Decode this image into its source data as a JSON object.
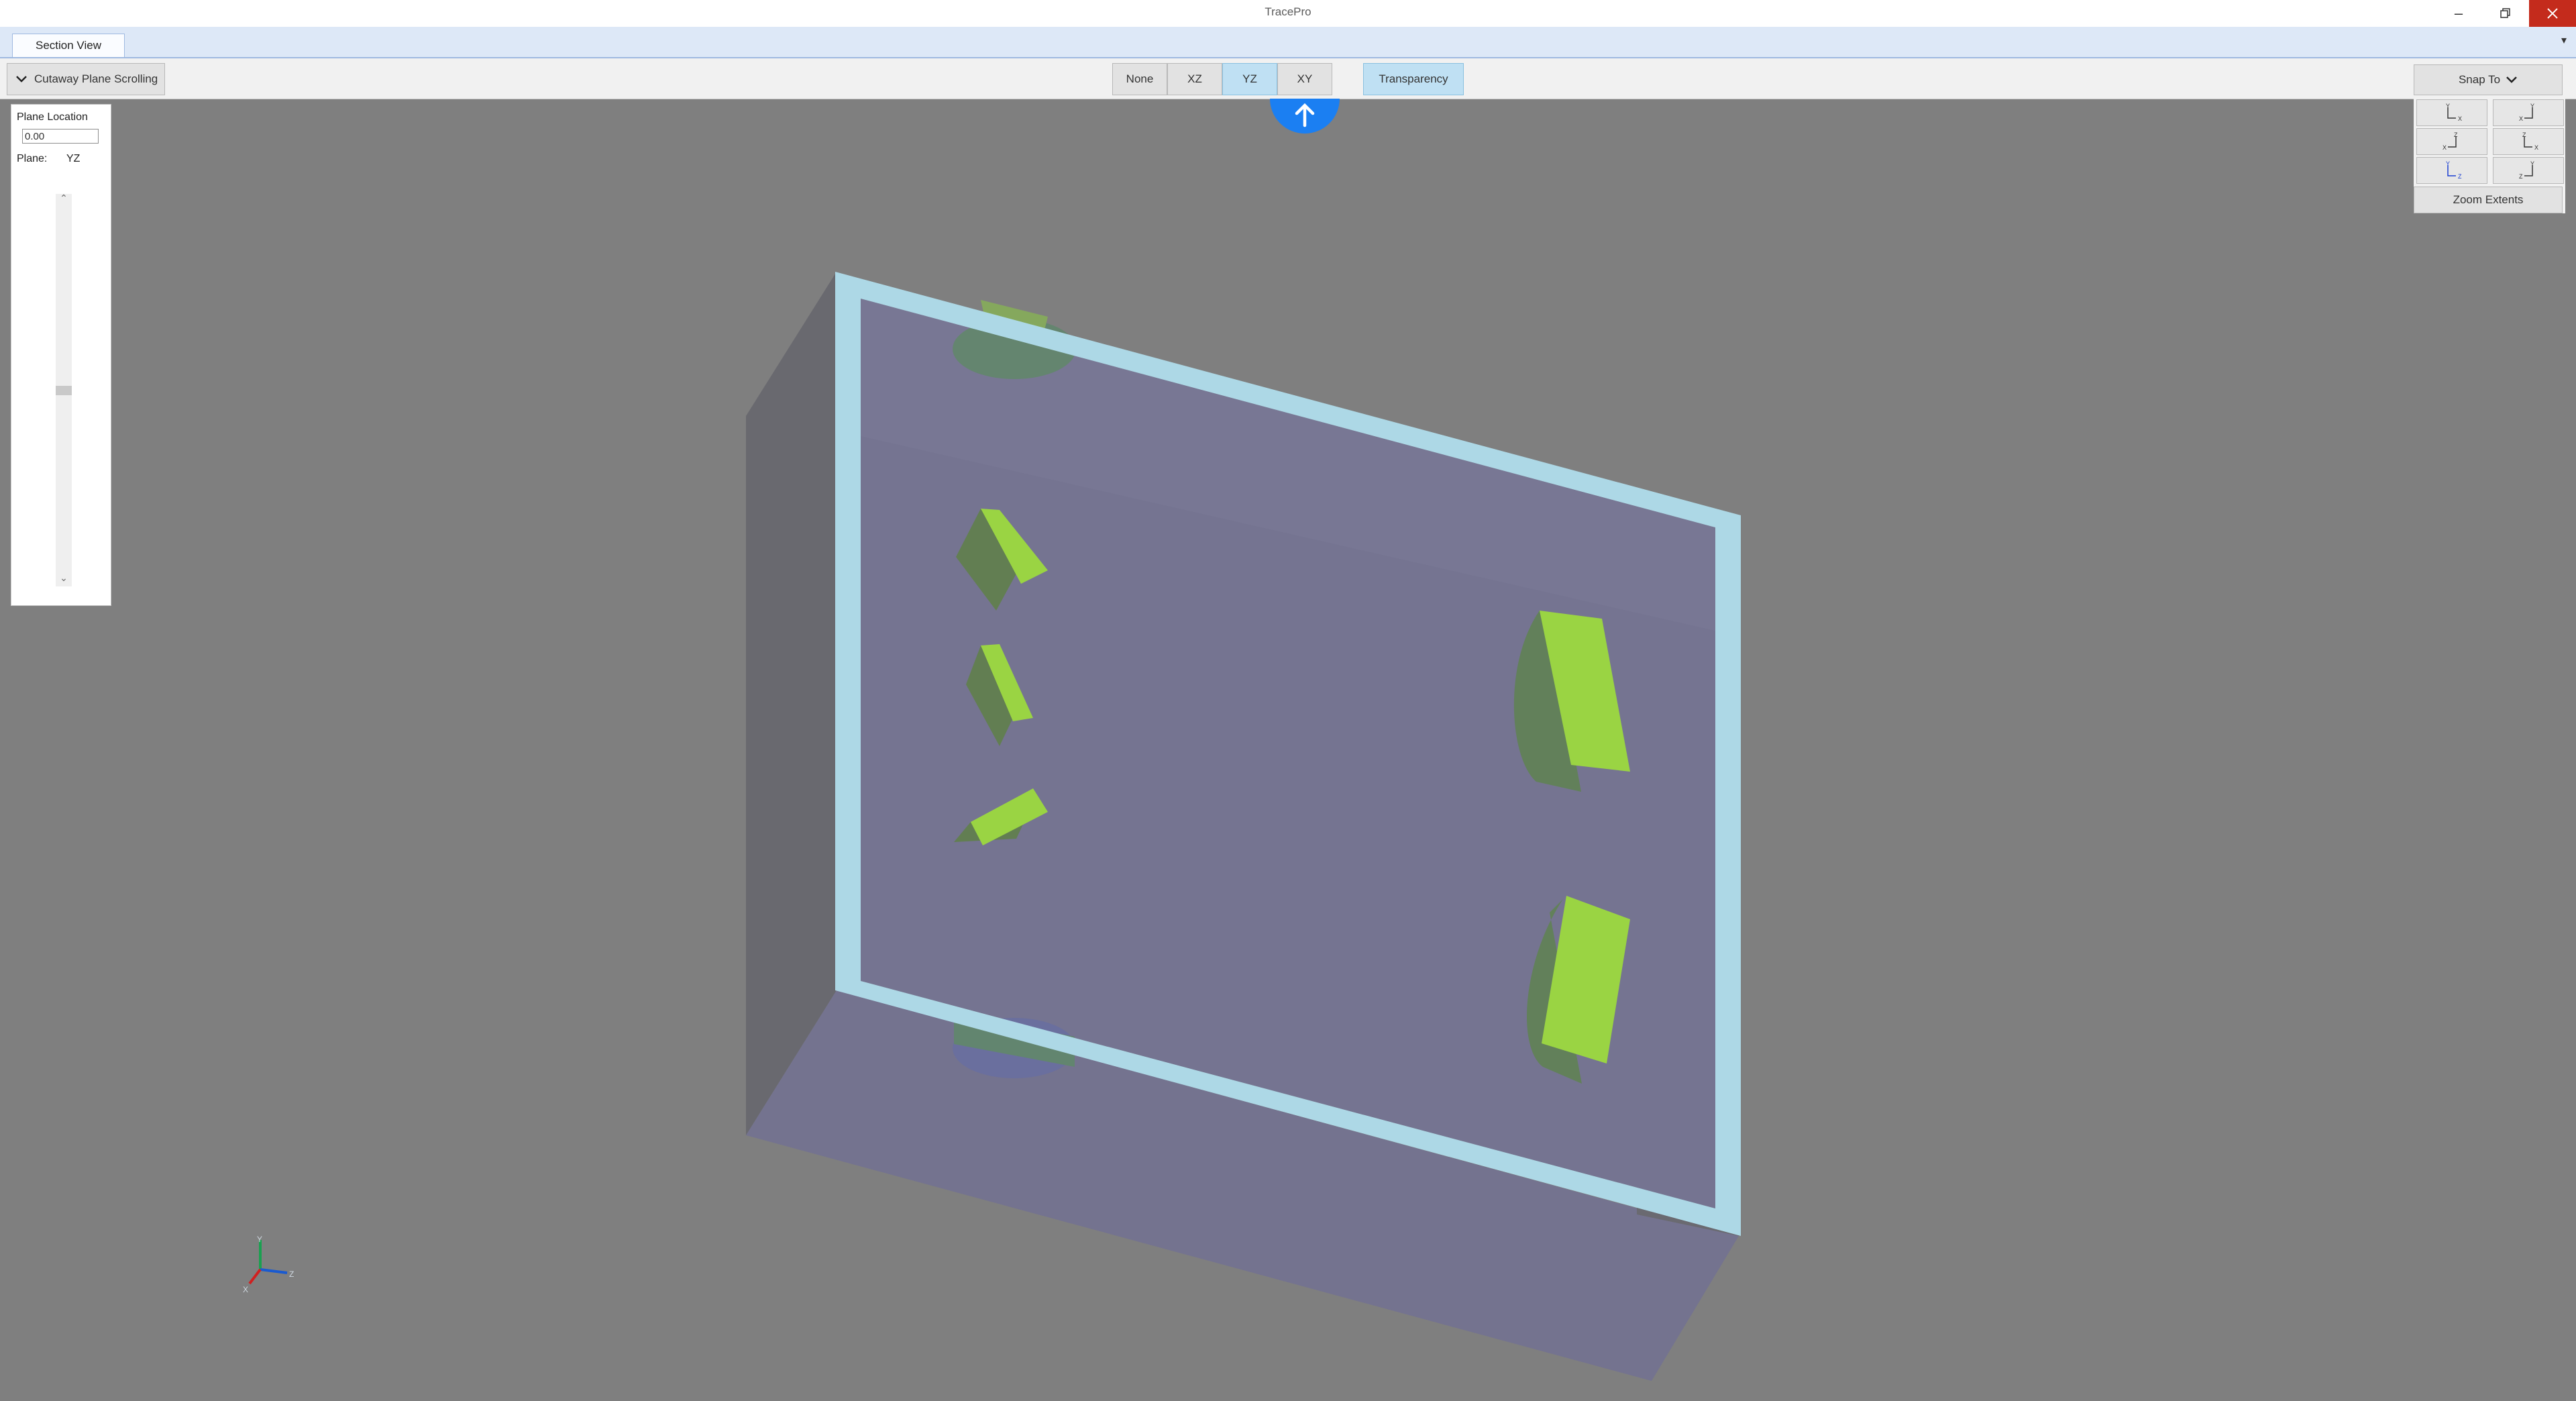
{
  "window": {
    "title": "TracePro"
  },
  "tabs": [
    {
      "label": "Section View"
    }
  ],
  "toolbar": {
    "cutaway_label": "Cutaway Plane Scrolling",
    "planes": [
      "None",
      "XZ",
      "YZ",
      "XY"
    ],
    "active_plane": "YZ",
    "transparency_label": "Transparency"
  },
  "panel": {
    "plane_location_label": "Plane Location",
    "plane_location_value": "0.00",
    "plane_label": "Plane:",
    "plane_value": "YZ",
    "slider_position": 0.5
  },
  "snap": {
    "label": "Snap To",
    "views": [
      {
        "up": "Y",
        "right": "X"
      },
      {
        "up": "Y",
        "right": "X",
        "mirrored": true
      },
      {
        "up": "Z",
        "right": "X",
        "mirrored": true
      },
      {
        "up": "Z",
        "right": "X"
      },
      {
        "up": "Y",
        "right": "Z",
        "selected": true
      },
      {
        "up": "Y",
        "right": "Z",
        "mirrored": true
      }
    ],
    "zoom_extents_label": "Zoom Extents"
  },
  "axes": {
    "x_label": "X",
    "y_label": "Y",
    "z_label": "Z"
  },
  "colors": {
    "background": "#7f7f7f",
    "active_button": "#bfe0f3",
    "frame_edge": "#add8e6",
    "solid_face": "#757491",
    "green_part": "#9ad443",
    "close_button": "#c42b1c",
    "up_arrow_button": "#1b7ff2"
  }
}
